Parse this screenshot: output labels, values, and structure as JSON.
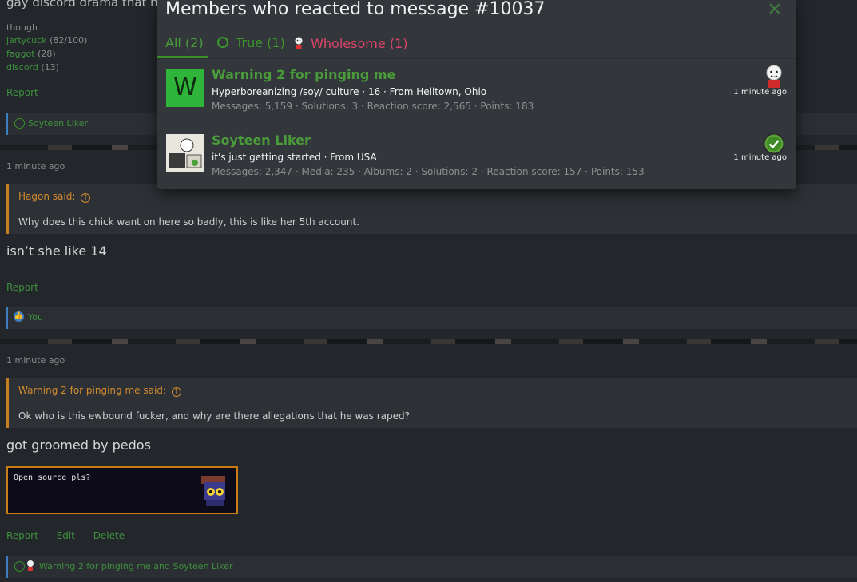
{
  "background_thread": {
    "top_title_fragment": "gay discord drama that h",
    "tags": {
      "label": "though",
      "items": [
        {
          "name": "jartycuck",
          "count": "(82/100)"
        },
        {
          "name": "faggot",
          "count": "(28)"
        },
        {
          "name": "discord",
          "count": "(13)"
        }
      ]
    },
    "post1": {
      "report": "Report",
      "reaction_summary": "Soyteen Liker"
    },
    "post2": {
      "time": "1 minute ago",
      "quote_author": "Hagon said:",
      "quote_text": "Why does this chick want on here so badly, this is like her 5th account.",
      "message": "isn’t she like 14",
      "report": "Report",
      "reaction_summary": "You"
    },
    "post3": {
      "time": "1 minute ago",
      "quote_author": "Warning 2 for pinging me said:",
      "quote_text": "Ok who is this ewbound fucker, and why are there allegations that he was raped?",
      "message": "got groomed by pedos",
      "embed_text": "Open source pls?",
      "actions": {
        "report": "Report",
        "edit": "Edit",
        "delete": "Delete"
      },
      "reaction_summary": "Warning 2 for pinging me and Soyteen Liker"
    }
  },
  "modal": {
    "title": "Members who reacted to message #10037",
    "close_icon": "close-icon",
    "tabs": [
      {
        "label": "All (2)",
        "active": true,
        "color": "#4a9b3a"
      },
      {
        "label": "True (1)",
        "icon": "check-circle-icon",
        "color": "#3a9a2a"
      },
      {
        "label": "Wholesome (1)",
        "icon": "wholesome-face-icon",
        "color": "#e0446a"
      }
    ],
    "members": [
      {
        "avatar_letter": "W",
        "avatar_color": "#2fb53a",
        "name": "Warning 2 for pinging me",
        "title": "Hyperboreanizing /soy/ culture · 16 · From Helltown, Ohio",
        "stats": "Messages: 5,159 · Solutions: 3 · Reaction score: 2,565 · Points: 183",
        "reaction_icon": "wholesome-face-icon",
        "time": "1 minute ago"
      },
      {
        "name": "Soyteen Liker",
        "title": "it's just getting started · From USA",
        "stats": "Messages: 2,347 · Media: 235 · Albums: 2 · Solutions: 2 · Reaction score: 157 · Points: 153",
        "reaction_icon": "check-circle-icon",
        "time": "1 minute ago"
      }
    ]
  },
  "colors": {
    "accent_green": "#4a9b3a",
    "quote_orange": "#c77d22",
    "page_bg": "#23272b",
    "modal_bg": "#33373c"
  }
}
